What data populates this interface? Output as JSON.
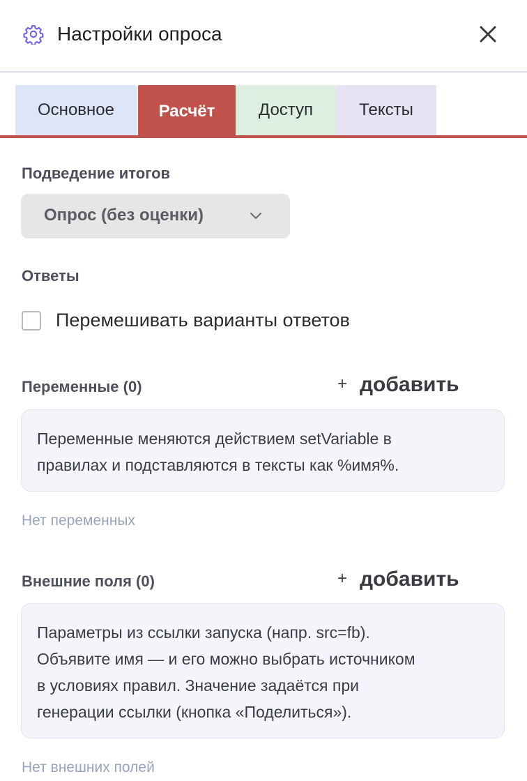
{
  "header": {
    "title": "Настройки опроса"
  },
  "tabs": [
    {
      "label": "Основное"
    },
    {
      "label": "Расчёт",
      "active": true
    },
    {
      "label": "Доступ"
    },
    {
      "label": "Тексты"
    }
  ],
  "colors": {
    "accent": "#c0524c",
    "tab_basic": "#dde6f8",
    "tab_access": "#dcefe0",
    "tab_texts": "#e7e2f4",
    "gear_icon": "#6c5ce7"
  },
  "results": {
    "label": "Подведение итогов",
    "selected": "Опрос (без оценки)"
  },
  "answers": {
    "label": "Ответы",
    "shuffle_label": "Перемешивать варианты ответов",
    "shuffle_checked": false
  },
  "variables": {
    "label": "Переменные (0)",
    "add_label": "добавить",
    "info_lines": [
      "Переменные меняются действием setVariable в",
      "правилах и подставляются в тексты как %имя%."
    ],
    "empty": "Нет переменных"
  },
  "external_fields": {
    "label": "Внешние поля (0)",
    "add_label": "добавить",
    "info_lines": [
      "Параметры из ссылки запуска (напр. src=fb).",
      "Объявите имя — и его можно выбрать источником",
      "в условиях правил. Значение задаётся при",
      "генерации ссылки (кнопка «Поделиться»)."
    ],
    "empty": "Нет внешних полей"
  }
}
